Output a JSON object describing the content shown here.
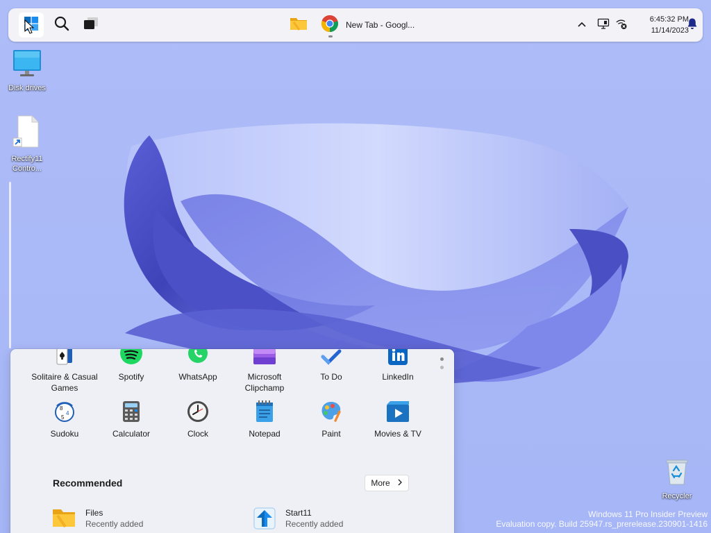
{
  "taskbar": {
    "start_icon": "windows-logo-icon",
    "search_icon": "search-icon",
    "task_view_icon": "task-view-icon",
    "pinned": [
      {
        "icon": "folder-icon"
      },
      {
        "icon": "chrome-icon",
        "label": "New Tab - Googl..."
      }
    ],
    "tray": {
      "overflow_icon": "chevron-up-icon",
      "display_icon": "display-icon",
      "network_icon": "network-disconnected-icon",
      "notifications_icon": "bell-icon"
    },
    "clock": {
      "time": "6:45:32 PM",
      "date": "11/14/2023"
    }
  },
  "desktop": {
    "icons": [
      {
        "icon": "monitor-icon",
        "label": "Disk drives"
      },
      {
        "icon": "file-shortcut-icon",
        "label": "Rectify11 Contro..."
      },
      {
        "icon": "recycle-bin-icon",
        "label": "Recycler"
      }
    ]
  },
  "start_menu": {
    "pinned": [
      {
        "icon": "solitaire-icon",
        "label": "Solitaire & Casual Games"
      },
      {
        "icon": "spotify-icon",
        "label": "Spotify"
      },
      {
        "icon": "whatsapp-icon",
        "label": "WhatsApp"
      },
      {
        "icon": "clipchamp-icon",
        "label": "Microsoft Clipchamp"
      },
      {
        "icon": "todo-icon",
        "label": "To Do"
      },
      {
        "icon": "linkedin-icon",
        "label": "LinkedIn"
      },
      {
        "icon": "sudoku-icon",
        "label": "Sudoku"
      },
      {
        "icon": "calculator-icon",
        "label": "Calculator"
      },
      {
        "icon": "clock-icon",
        "label": "Clock"
      },
      {
        "icon": "notepad-icon",
        "label": "Notepad"
      },
      {
        "icon": "paint-icon",
        "label": "Paint"
      },
      {
        "icon": "movies-tv-icon",
        "label": "Movies & TV"
      }
    ],
    "recommended": {
      "title": "Recommended",
      "more_label": "More",
      "items": [
        {
          "icon": "folder-icon",
          "name": "Files",
          "sub": "Recently added"
        },
        {
          "icon": "start11-icon",
          "name": "Start11",
          "sub": "Recently added"
        }
      ]
    }
  },
  "watermark": {
    "line1": "Windows 11 Pro Insider Preview",
    "line2": "Evaluation copy. Build 25947.rs_prerelease.230901-1416"
  },
  "colors": {
    "wallpaper": "#a9b8f7",
    "bloom_dark": "#4a4fc4",
    "bloom_light": "#c9d2fb",
    "taskbar": "#f3f3f7",
    "start_menu": "#eef0f5"
  }
}
